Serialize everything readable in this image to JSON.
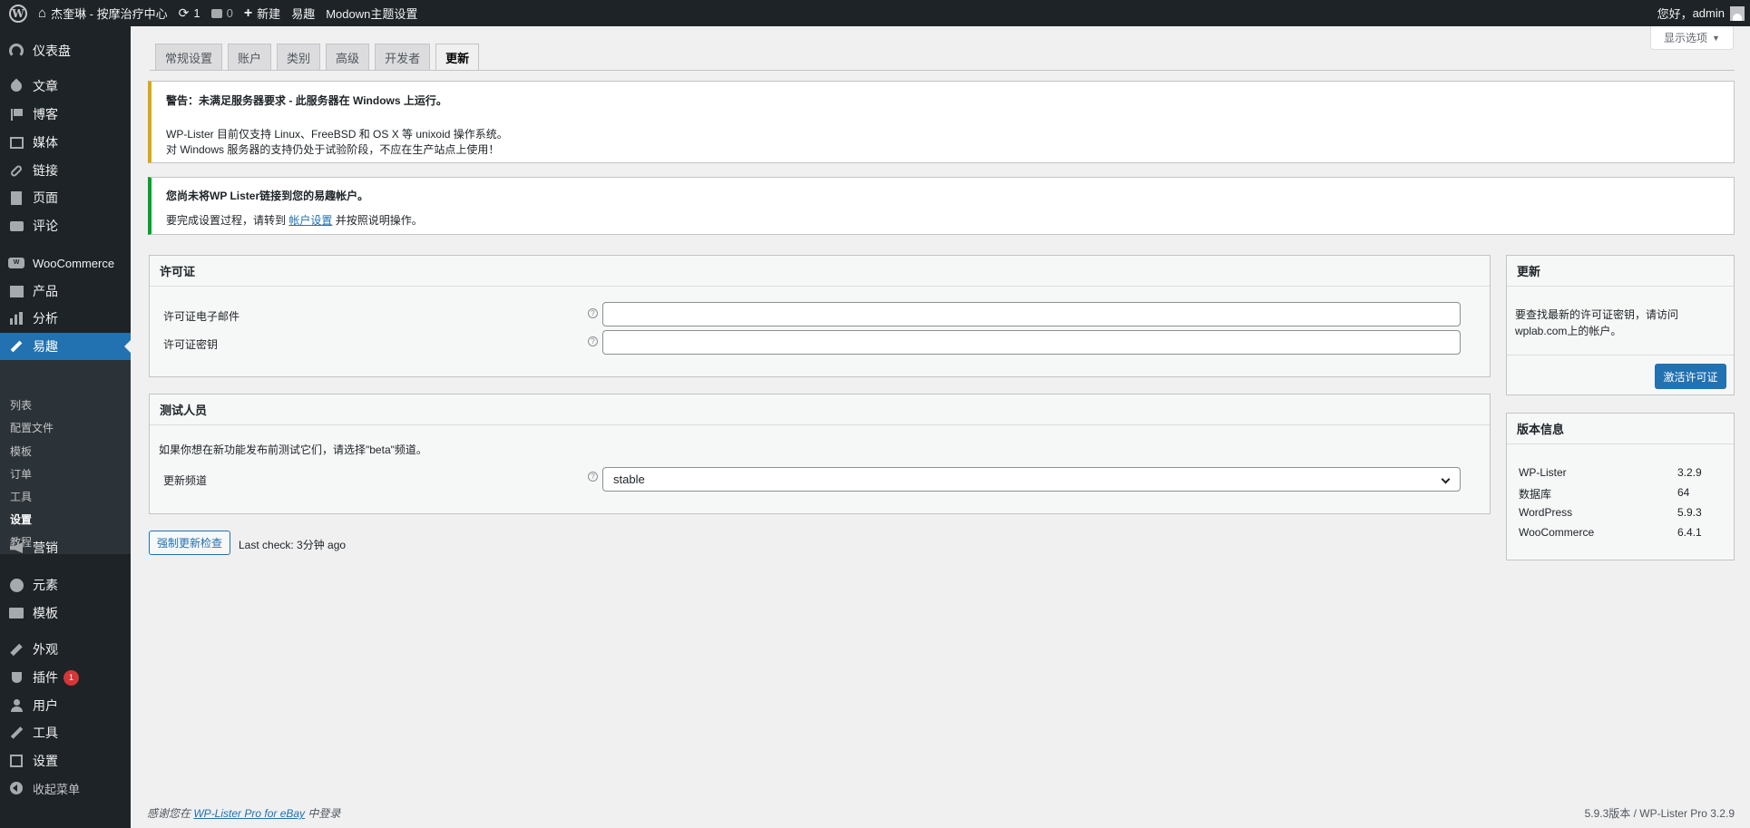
{
  "adminbar": {
    "site_name": "杰奎琳 - 按摩治疗中心",
    "updates_count": "1",
    "comments_count": "0",
    "new_label": "新建",
    "yiqu_label": "易趣",
    "theme_settings_label": "Modown主题设置",
    "greeting": "您好，",
    "username": "admin"
  },
  "sidebar": {
    "items": [
      {
        "label": "仪表盘",
        "icon": "dashboard-icon"
      },
      {
        "label": "文章",
        "icon": "pin-icon"
      },
      {
        "label": "博客",
        "icon": "flag-icon"
      },
      {
        "label": "媒体",
        "icon": "media-icon"
      },
      {
        "label": "链接",
        "icon": "link-icon"
      },
      {
        "label": "页面",
        "icon": "page-icon"
      },
      {
        "label": "评论",
        "icon": "comment-icon"
      },
      {
        "label": "WooCommerce",
        "icon": "woo-icon"
      },
      {
        "label": "产品",
        "icon": "box-icon"
      },
      {
        "label": "分析",
        "icon": "bar-chart-icon"
      },
      {
        "label": "易趣",
        "icon": "hammer-icon"
      },
      {
        "label": "营销",
        "icon": "megaphone-icon"
      },
      {
        "label": "元素",
        "icon": "elementor-icon"
      },
      {
        "label": "模板",
        "icon": "folder-icon"
      },
      {
        "label": "外观",
        "icon": "brush-icon"
      },
      {
        "label": "插件",
        "icon": "plugin-icon",
        "badge": "1"
      },
      {
        "label": "用户",
        "icon": "user-icon"
      },
      {
        "label": "工具",
        "icon": "wrench-icon"
      },
      {
        "label": "设置",
        "icon": "settings-icon"
      },
      {
        "label": "收起菜单",
        "icon": "collapse-icon"
      }
    ],
    "submenu": [
      "列表",
      "配置文件",
      "模板",
      "订单",
      "工具",
      "设置",
      "教程"
    ]
  },
  "screen_options": "显示选项",
  "tabs": [
    "常规设置",
    "账户",
    "类别",
    "高级",
    "开发者",
    "更新"
  ],
  "notice_warning": {
    "title": "警告：未满足服务器要求 - 此服务器在 Windows 上运行。",
    "line1": "WP-Lister 目前仅支持 Linux、FreeBSD 和 OS X 等 unixoid 操作系统。",
    "line2": "对 Windows 服务器的支持仍处于试验阶段，不应在生产站点上使用！"
  },
  "notice_account": {
    "title": "您尚未将WP Lister链接到您的易趣帐户。",
    "text_before": "要完成设置过程，请转到",
    "link": "帐户设置",
    "text_after": "并按照说明操作。"
  },
  "license_box": {
    "title": "许可证",
    "email_label": "许可证电子邮件",
    "email_value": "",
    "key_label": "许可证密钥",
    "key_value": ""
  },
  "beta_box": {
    "title": "测试人员",
    "description": "如果你想在新功能发布前测试它们，请选择\"beta\"频道。",
    "channel_label": "更新频道",
    "channel_value": "stable"
  },
  "force_check": {
    "button": "强制更新检查",
    "last_check": "Last check: 3分钟 ago"
  },
  "update_box": {
    "title": "更新",
    "line1": "要查找最新的许可证密钥，请访问",
    "line2": "wplab.com上的帐户。",
    "button": "激活许可证"
  },
  "version_box": {
    "title": "版本信息",
    "rows": [
      {
        "name": "WP-Lister",
        "value": "3.2.9"
      },
      {
        "name": "数据库",
        "value": "64"
      },
      {
        "name": "WordPress",
        "value": "5.9.3"
      },
      {
        "name": "WooCommerce",
        "value": "6.4.1"
      }
    ]
  },
  "footer": {
    "left_before": "感谢您在",
    "left_link": "WP-Lister Pro for eBay",
    "left_after": "中登录",
    "right": "5.9.3版本 / WP-Lister Pro 3.2.9"
  },
  "colors": {
    "accent": "#2271b1",
    "warning": "#dba617",
    "success": "#00a32a",
    "badge": "#d63638",
    "sidebar_bg": "#1d2327"
  }
}
